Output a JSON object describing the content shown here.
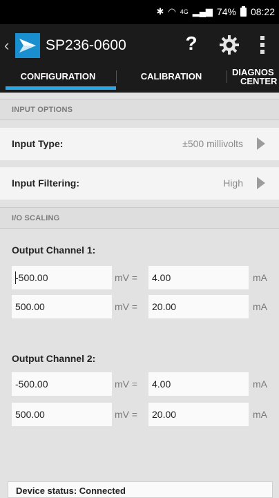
{
  "status_bar": {
    "battery": "74%",
    "time": "08:22",
    "network": "4G"
  },
  "app_bar": {
    "title": "SP236-0600",
    "help_label": "?"
  },
  "tabs": [
    {
      "label": "CONFIGURATION"
    },
    {
      "label": "CALIBRATION"
    },
    {
      "label_line1": "DIAGNOS",
      "label_line2": "CENTER"
    }
  ],
  "input_options": {
    "header": "INPUT OPTIONS",
    "input_type": {
      "label": "Input Type:",
      "value": "±500 millivolts"
    },
    "input_filtering": {
      "label": "Input Filtering:",
      "value": "High"
    }
  },
  "io_scaling": {
    "header": "I/O SCALING",
    "channels": [
      {
        "label": "Output Channel 1:",
        "rows": [
          {
            "input": "-500.00",
            "unit_in": "mV =",
            "output": "4.00",
            "unit_out": "mA"
          },
          {
            "input": "500.00",
            "unit_in": "mV =",
            "output": "20.00",
            "unit_out": "mA"
          }
        ]
      },
      {
        "label": "Output Channel 2:",
        "rows": [
          {
            "input": "-500.00",
            "unit_in": "mV =",
            "output": "4.00",
            "unit_out": "mA"
          },
          {
            "input": "500.00",
            "unit_in": "mV =",
            "output": "20.00",
            "unit_out": "mA"
          }
        ]
      }
    ]
  },
  "device_status": "Device status:  Connected"
}
